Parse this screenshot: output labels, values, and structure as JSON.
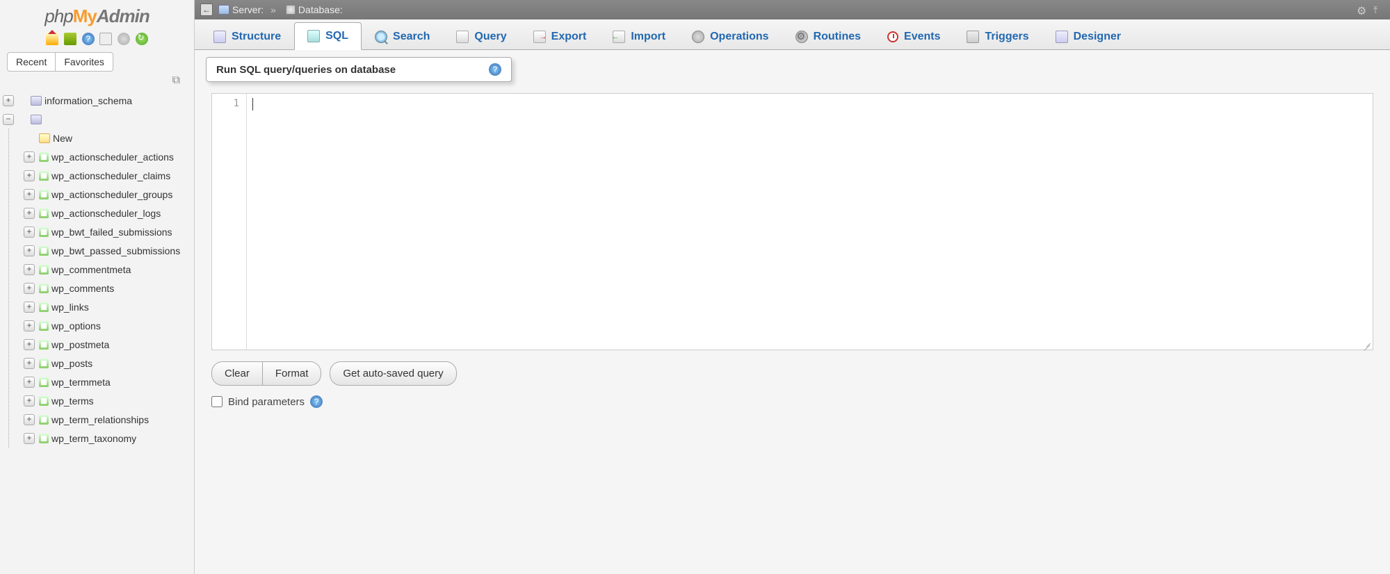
{
  "logo": {
    "php": "php",
    "my": "My",
    "admin": "Admin"
  },
  "sidebar": {
    "nav_toggle": {
      "recent": "Recent",
      "favorites": "Favorites"
    },
    "tree": {
      "root_db": "information_schema",
      "new_label": "New",
      "tables": [
        "wp_actionscheduler_actions",
        "wp_actionscheduler_claims",
        "wp_actionscheduler_groups",
        "wp_actionscheduler_logs",
        "wp_bwt_failed_submissions",
        "wp_bwt_passed_submissions",
        "wp_commentmeta",
        "wp_comments",
        "wp_links",
        "wp_options",
        "wp_postmeta",
        "wp_posts",
        "wp_termmeta",
        "wp_terms",
        "wp_term_relationships",
        "wp_term_taxonomy"
      ]
    }
  },
  "breadcrumb": {
    "server_label": "Server:",
    "server_value": "",
    "database_label": "Database:",
    "database_value": ""
  },
  "tabs": [
    {
      "id": "structure",
      "label": "Structure",
      "icon": "ic-struct"
    },
    {
      "id": "sql",
      "label": "SQL",
      "icon": "ic-sqlwin",
      "active": true
    },
    {
      "id": "search",
      "label": "Search",
      "icon": "ic-search"
    },
    {
      "id": "query",
      "label": "Query",
      "icon": "ic-query"
    },
    {
      "id": "export",
      "label": "Export",
      "icon": "ic-export"
    },
    {
      "id": "import",
      "label": "Import",
      "icon": "ic-import"
    },
    {
      "id": "operations",
      "label": "Operations",
      "icon": "ic-ops-alt"
    },
    {
      "id": "routines",
      "label": "Routines",
      "icon": "ic-routines"
    },
    {
      "id": "events",
      "label": "Events",
      "icon": "ic-events"
    },
    {
      "id": "triggers",
      "label": "Triggers",
      "icon": "ic-triggers"
    },
    {
      "id": "designer",
      "label": "Designer",
      "icon": "ic-designer"
    }
  ],
  "panel": {
    "title": "Run SQL query/queries on database"
  },
  "editor": {
    "line_number": "1",
    "content": ""
  },
  "buttons": {
    "clear": "Clear",
    "format": "Format",
    "autosaved": "Get auto-saved query"
  },
  "bind_params": {
    "label": "Bind parameters",
    "checked": false
  }
}
